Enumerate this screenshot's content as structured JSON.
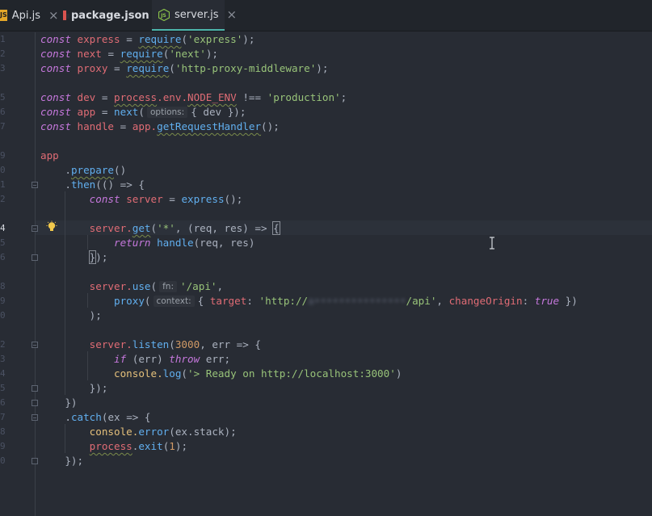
{
  "tabs": [
    {
      "label": "Api.js",
      "icon": "js-file-icon",
      "active": false
    },
    {
      "label": "package.json",
      "icon": "npm-file-icon",
      "active": false
    },
    {
      "label": "server.js",
      "icon": "nodejs-file-icon",
      "active": true
    }
  ],
  "tab_close_glyph": "×",
  "gutter": {
    "line_numbers": [
      "1",
      "2",
      "3",
      "",
      "5",
      "6",
      "7",
      "",
      "9",
      "0",
      "1",
      "2",
      "",
      "4",
      "5",
      "6",
      "",
      "8",
      "9",
      "0",
      "",
      "2",
      "3",
      "4",
      "5",
      "6",
      "7",
      "8",
      "9",
      "0"
    ],
    "current_line": "4"
  },
  "hints": {
    "options": "options:",
    "fn": "fn:",
    "context": "context:"
  },
  "code": {
    "l1": [
      "const",
      "express",
      "=",
      "require",
      "(",
      "'express'",
      ");"
    ],
    "l2": [
      "const",
      "next",
      "=",
      "require",
      "(",
      "'next'",
      ");"
    ],
    "l3": [
      "const",
      "proxy",
      "=",
      "require",
      "(",
      "'http-proxy-middleware'",
      ");"
    ],
    "l5": [
      "const",
      "dev",
      "=",
      "process",
      ".env.",
      "NODE_ENV",
      "!==",
      "'production'",
      ";"
    ],
    "l6": [
      "const",
      "app",
      "=",
      "next",
      "(",
      "{ dev }",
      ");"
    ],
    "l7": [
      "const",
      "handle",
      "=",
      "app.",
      "getRequestHandler",
      "();"
    ],
    "l9": "app",
    "l10": [
      ".",
      "prepare",
      "()"
    ],
    "l11": [
      ".",
      "then",
      "(() => {"
    ],
    "l12": [
      "const",
      "server",
      "=",
      "express",
      "();"
    ],
    "l14": [
      "server.",
      "get",
      "(",
      "'*'",
      ", (req, res) => ",
      "{"
    ],
    "l15": [
      "return",
      "handle",
      "(req, res)"
    ],
    "l16": [
      "}",
      ");"
    ],
    "l18": [
      "server.",
      "use",
      "(",
      "'/api'",
      ","
    ],
    "l19": [
      "proxy",
      "(",
      "{ ",
      "target",
      ": ",
      "'http://",
      "a•••••••••••••••",
      "/api'",
      ", ",
      "changeOrigin",
      ": ",
      "true",
      " })"
    ],
    "l20": ");",
    "l22": [
      "server.",
      "listen",
      "(",
      "3000",
      ", err => {"
    ],
    "l23": [
      "if",
      "(err) ",
      "throw",
      " err;"
    ],
    "l24": [
      "console.",
      "log",
      "(",
      "'> Ready on http://localhost:3000'",
      ")"
    ],
    "l25": "});",
    "l26": "})",
    "l27": [
      ".",
      "catch",
      "(ex => {"
    ],
    "l28": [
      "console.",
      "error",
      "(ex.stack);"
    ],
    "l29": [
      "process",
      ".",
      "exit",
      "(",
      "1",
      ");"
    ],
    "l30": "});"
  }
}
